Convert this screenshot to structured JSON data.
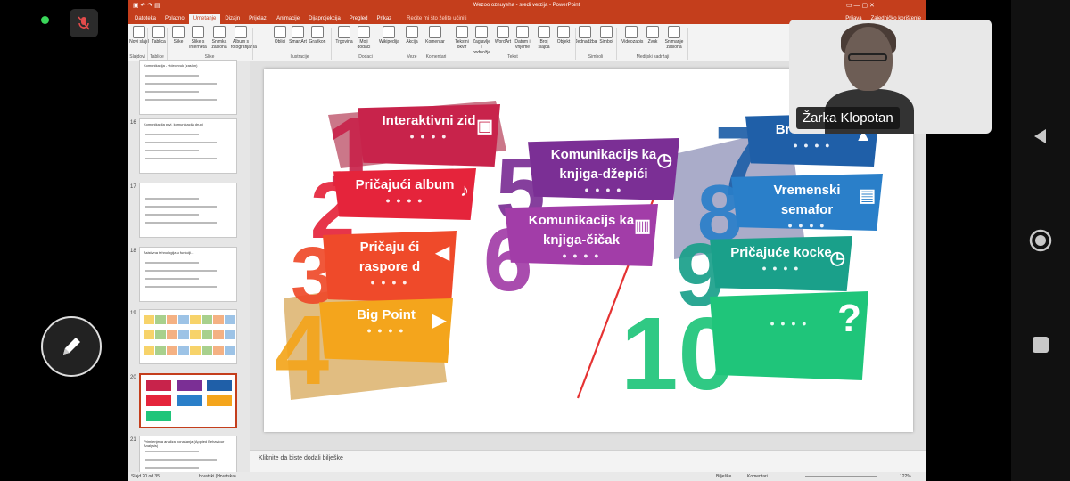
{
  "window": {
    "title": "Wezoo oznuyeha - sredi verzija - PowerPoint"
  },
  "menu": [
    {
      "label": "Datoteka",
      "active": false
    },
    {
      "label": "Polazno",
      "active": false
    },
    {
      "label": "Umetanje",
      "active": true
    },
    {
      "label": "Dizajn",
      "active": false
    },
    {
      "label": "Prijelazi",
      "active": false
    },
    {
      "label": "Animacije",
      "active": false
    },
    {
      "label": "Dijaprojekcija",
      "active": false
    },
    {
      "label": "Pregled",
      "active": false
    },
    {
      "label": "Prikaz",
      "active": false
    }
  ],
  "tell_me": "Recite mi što želite učiniti",
  "account": {
    "user": "Prijava",
    "share": "Zajedničko korištenje"
  },
  "ribbon": {
    "buttons": [
      "Novi slajd",
      "Tablica",
      "Slike",
      "Slike s interneta",
      "Snimka zaslona",
      "Album s fotografijama",
      "Oblici",
      "SmartArt",
      "Grafikon",
      "Trgovina",
      "Moji dodaci",
      "Wikipedija",
      "Akcija",
      "Komentar",
      "Tekstni okvir",
      "Zaglavlje i podnožje",
      "WordArt",
      "Datum i vrijeme",
      "Broj slajda",
      "Objekt",
      "Jednadžba",
      "Simbol",
      "Videozapis",
      "Zvuk",
      "Snimanje zaslona"
    ],
    "groups": [
      "Slajdovi",
      "Tablice",
      "Slike",
      "Ilustracije",
      "Dodaci",
      "Veze",
      "Komentari",
      "Tekst",
      "Simboli",
      "Medijski sadržaji"
    ]
  },
  "thumbnails": [
    {
      "no": "",
      "title": "Komunikacija - videozvuk (zaslon)"
    },
    {
      "no": "16",
      "title": "Komunikacija prvi, komunikacija drugi"
    },
    {
      "no": "17",
      "title": ""
    },
    {
      "no": "18",
      "title": "Asistivna tehnologija u funkciji..."
    },
    {
      "no": "19",
      "title": ""
    },
    {
      "no": "20",
      "title": ""
    },
    {
      "no": "21",
      "title": "Primijenjena analiza ponašanja (Applied Behaviour Analysis)"
    }
  ],
  "slide": {
    "cards": [
      {
        "n": "1",
        "text": "Interaktivni zid",
        "color": "#c8234b",
        "icon": "presentation-board-icon"
      },
      {
        "n": "2",
        "text": "Pričajući album",
        "color": "#e5243b",
        "icon": "microphone-icon"
      },
      {
        "n": "3",
        "text": "Pričaju ći raspore d",
        "color": "#ef4a2a",
        "icon": "megaphone-icon"
      },
      {
        "n": "4",
        "text": "Big Point",
        "color": "#f4a51c",
        "icon": "play-icon"
      },
      {
        "n": "5",
        "text": "Komunikacijs ka knjiga-džepići",
        "color": "#7b2f95",
        "icon": "stopwatch-icon"
      },
      {
        "n": "6",
        "text": "Komunikacijs ka knjiga-čičak",
        "color": "#a23da8",
        "icon": "book-icon"
      },
      {
        "n": "7",
        "text": "Br vremena",
        "color": "#1f5fa8",
        "icon": "bell-icon"
      },
      {
        "n": "8",
        "text": "Vremenski semafor",
        "color": "#2a7fc9",
        "icon": "notepad-icon"
      },
      {
        "n": "9",
        "text": "Pričajuće kocke",
        "color": "#1aa08a",
        "icon": "stopwatch-icon"
      },
      {
        "n": "10",
        "text": "",
        "color": "#1fc57a",
        "icon": "question-bubble-icon"
      }
    ]
  },
  "notes_placeholder": "Kliknite da biste dodali bilješke",
  "status": {
    "slide": "Slajd 20 od 35",
    "language": "hrvatski (Hrvatska)",
    "notes": "Bilješke",
    "comments": "Komentari",
    "zoom": "122%"
  },
  "video": {
    "participant": "Žarka Klopotan"
  }
}
